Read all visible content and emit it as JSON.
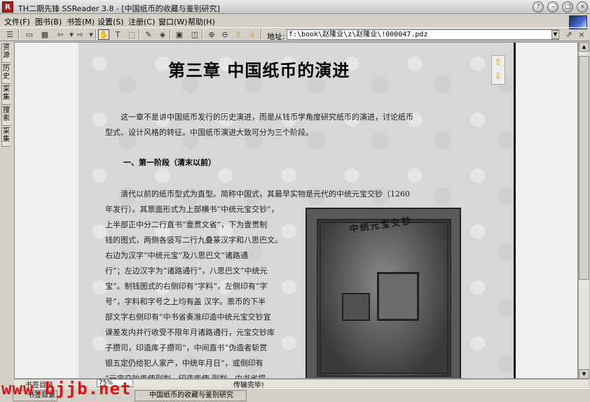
{
  "window": {
    "title": "TH二期先锋 SSReader 3.8 - [中国纸币的收藏与鉴别研究]",
    "app_icon": "ssreader-icon"
  },
  "menu": [
    "文件(F)",
    "图书(B)",
    "书签(M)",
    "设置(S)",
    "注册(C)",
    "窗口(W)",
    "帮助(H)"
  ],
  "address": {
    "label": "地址:",
    "value": "f:\\book\\赵隆业\\z\\赵隆业\\!000047.pdz"
  },
  "sidebar_tabs": [
    "资源",
    "历史",
    "采集",
    "搜索",
    "采集"
  ],
  "document": {
    "chapter_title": "第三章 中国纸币的演进",
    "intro_line1": "这一章不是讲中国纸币发行的历史演进，而是从钱币学角度研究纸币的演进，讨论纸币",
    "intro_line2": "型式、设计风格的转征。中国纸币演进大致可分为三个阶段。",
    "section_heading": "一、第一阶段（清末以前）",
    "lines": [
      "清代以前的纸币型式为直型。简称中国式，其最早实物是元代的中统元宝交钞（1260",
      "年发行）。其票面形式为上部横书“中统元宝交钞”，",
      "上半部正中分二行直书“壹贯文省”，下为壹贯制",
      "钱的图式，两侧各竖写二行九叠篆汉字和八思巴文。",
      "右边为汉字“中统元宝”及八思巴文“诸路通",
      "行”；左边汉字为“诸路通行”，八思巴文“中统元",
      "宝”。制钱图式的右侧印有“字料”，左侧印有“字",
      "号”，字料和字号之上均有盖  汉字。票币的下半",
      "部文字右侧印有“中书省奏准印造中统元宝交钞宜",
      "课差发内并行收受不限年月诸路通行，元宝交钞库",
      "子攒司，印造库子攒司”，中间直书“伪造者斩赏",
      "银五定仍给犯人家产，中统年月日”，或侧印有",
      "“元宝交钞库使副判，印造库使  副判，中书省提"
    ],
    "banknote_caption": "中统元宝交钞"
  },
  "status": {
    "left": "书签目录",
    "zoom": "75%",
    "middle": "传输完毕!"
  },
  "taskbar": {
    "tasks": [
      "书签目录",
      "中国纸币的收藏与鉴别研究"
    ]
  },
  "watermark": "www.bjjb.net"
}
